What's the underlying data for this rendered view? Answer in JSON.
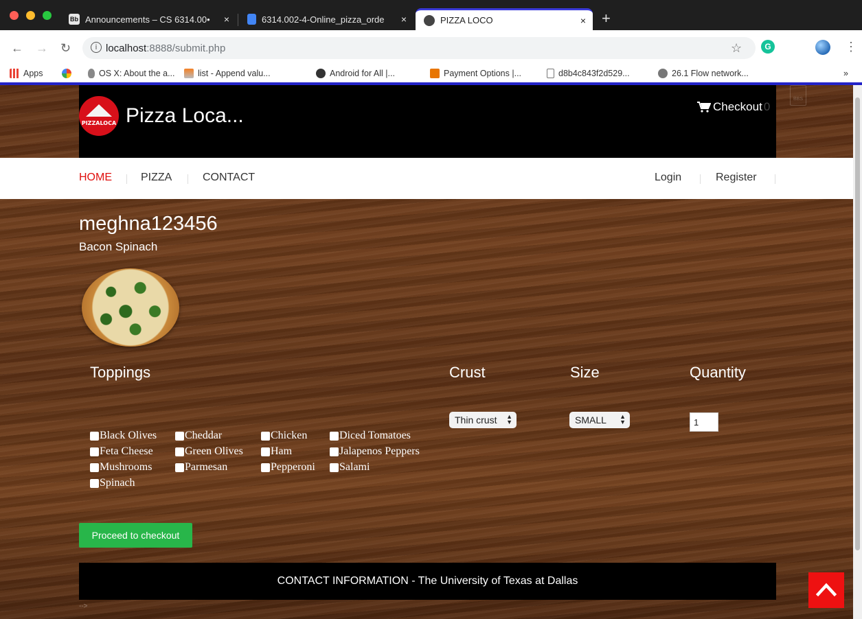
{
  "browser": {
    "tabs": [
      {
        "icon": "Bb",
        "label": "Announcements – CS 6314.00•",
        "close": "×"
      },
      {
        "icon": "doc",
        "label": "6314.002-4-Online_pizza_orde",
        "close": "×"
      },
      {
        "icon": "pizza",
        "label": "PIZZA LOCO",
        "close": "×"
      }
    ],
    "new_tab": "+",
    "url_host": "localhost",
    "url_path": ":8888/submit.php",
    "bookmarks": [
      {
        "label": "Apps"
      },
      {
        "label": ""
      },
      {
        "label": "OS X: About the a..."
      },
      {
        "label": "list - Append valu..."
      },
      {
        "label": "Android for All |..."
      },
      {
        "label": "Payment Options |..."
      },
      {
        "label": "d8b4c843f2d529..."
      },
      {
        "label": "26.1 Flow network..."
      }
    ],
    "bookmarks_more": "»",
    "extension_g": "G"
  },
  "header": {
    "logo_text": "PIZZALOCA",
    "brand": "Pizza Loca...",
    "checkout_label": "Checkout",
    "checkout_count": "0",
    "file_ghost_label": "BBS"
  },
  "nav": {
    "left": [
      "HOME",
      "PIZZA",
      "CONTACT"
    ],
    "right": [
      "Login",
      "Register"
    ]
  },
  "order": {
    "username": "meghna123456",
    "pizza_name": "Bacon Spinach",
    "toppings_heading": "Toppings",
    "crust_heading": "Crust",
    "size_heading": "Size",
    "quantity_heading": "Quantity",
    "toppings": [
      "Black Olives",
      "Cheddar",
      "Chicken",
      "Diced Tomatoes",
      "Feta Cheese",
      "Green Olives",
      "Ham",
      "Jalapenos Peppers",
      "Mushrooms",
      "Parmesan",
      "Pepperoni",
      "Salami",
      "Spinach"
    ],
    "crust_value": "Thin crust",
    "size_value": "SMALL",
    "quantity_value": "1",
    "proceed_label": "Proceed to checkout"
  },
  "footer": {
    "text": "CONTACT INFORMATION - The University of Texas at Dallas",
    "tiny": "-->"
  }
}
